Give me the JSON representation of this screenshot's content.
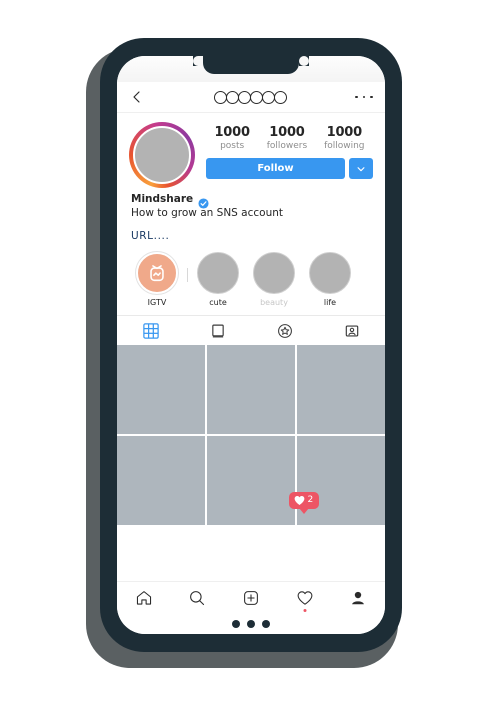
{
  "header": {
    "back_icon": "chevron-left-icon",
    "username_placeholder_circles": 6,
    "more_icon": "more-horizontal-icon"
  },
  "profile": {
    "avatar": {
      "icon": "avatar-placeholder",
      "has_story_ring": true,
      "ring_colors": [
        "#f9a03c",
        "#e8542f",
        "#c33b8f",
        "#8e3a9e"
      ]
    },
    "stats": [
      {
        "value": "1000",
        "label": "posts"
      },
      {
        "value": "1000",
        "label": "followers"
      },
      {
        "value": "1000",
        "label": "following"
      }
    ],
    "follow_button": {
      "label": "Follow",
      "color": "#3897f0"
    },
    "follow_dropdown_icon": "chevron-down-icon",
    "display_name": "Mindshare",
    "verified": true,
    "bio": "How to grow an SNS account",
    "url": "URL....",
    "url_color": "#1a3a63"
  },
  "highlights": [
    {
      "label": "IGTV",
      "icon": "igtv-icon",
      "style": "igtv",
      "muted": false
    },
    {
      "label": "cute",
      "icon": "highlight-placeholder",
      "style": "filled",
      "muted": false
    },
    {
      "label": "beauty",
      "icon": "highlight-placeholder",
      "style": "filled",
      "muted": true
    },
    {
      "label": "life",
      "icon": "highlight-placeholder",
      "style": "filled",
      "muted": false
    }
  ],
  "tabs": [
    {
      "icon": "grid-icon",
      "active": true,
      "color": "#3897f0"
    },
    {
      "icon": "reels-card-icon",
      "active": false,
      "color": "#3a3a3a"
    },
    {
      "icon": "star-circle-icon",
      "active": false,
      "color": "#3a3a3a"
    },
    {
      "icon": "tagged-person-icon",
      "active": false,
      "color": "#3a3a3a"
    }
  ],
  "grid": {
    "cells": 6,
    "cell_color": "#aeb6bd"
  },
  "like_bubble": {
    "icon": "heart-filled-icon",
    "count": "2",
    "color": "#ed5565"
  },
  "bottom_nav": [
    {
      "icon": "home-icon",
      "badge": false
    },
    {
      "icon": "search-icon",
      "badge": false
    },
    {
      "icon": "add-square-icon",
      "badge": false
    },
    {
      "icon": "heart-icon",
      "badge": true
    },
    {
      "icon": "profile-person-icon",
      "badge": false
    }
  ],
  "home_indicator_dots": 3
}
